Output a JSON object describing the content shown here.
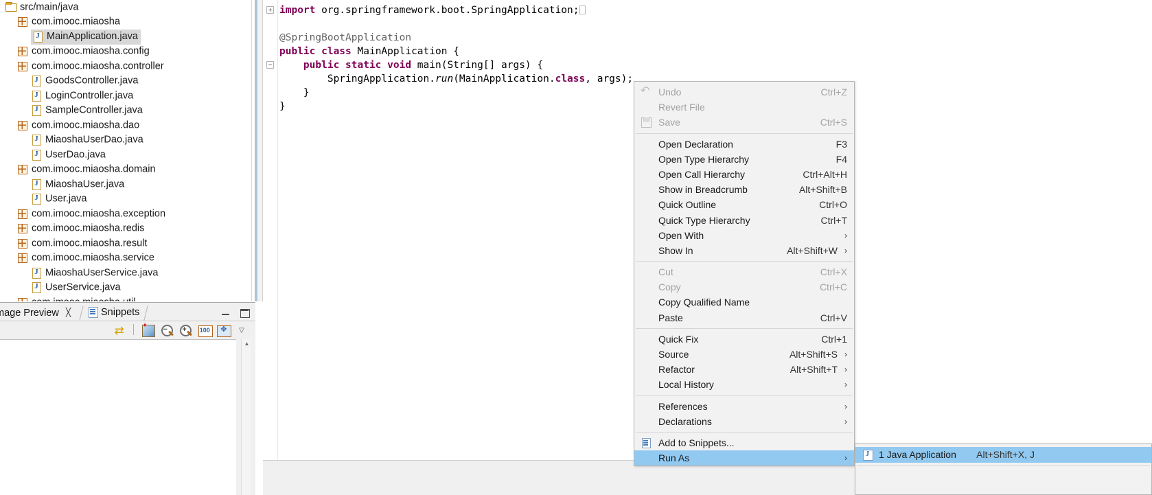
{
  "explorer": {
    "name": "package-explorer",
    "tree": [
      {
        "indent": 0,
        "icon": "folder-icon",
        "label": "src/main/java",
        "selected": false
      },
      {
        "indent": 1,
        "icon": "package-icon",
        "label": "com.imooc.miaosha",
        "selected": false
      },
      {
        "indent": 2,
        "icon": "java-file-icon",
        "label": "MainApplication.java",
        "selected": true
      },
      {
        "indent": 1,
        "icon": "package-icon",
        "label": "com.imooc.miaosha.config",
        "selected": false
      },
      {
        "indent": 1,
        "icon": "package-icon",
        "label": "com.imooc.miaosha.controller",
        "selected": false
      },
      {
        "indent": 2,
        "icon": "java-file-icon",
        "label": "GoodsController.java",
        "selected": false
      },
      {
        "indent": 2,
        "icon": "java-file-icon",
        "label": "LoginController.java",
        "selected": false
      },
      {
        "indent": 2,
        "icon": "java-file-icon",
        "label": "SampleController.java",
        "selected": false
      },
      {
        "indent": 1,
        "icon": "package-icon",
        "label": "com.imooc.miaosha.dao",
        "selected": false
      },
      {
        "indent": 2,
        "icon": "java-file-icon",
        "label": "MiaoshaUserDao.java",
        "selected": false
      },
      {
        "indent": 2,
        "icon": "java-file-icon",
        "label": "UserDao.java",
        "selected": false
      },
      {
        "indent": 1,
        "icon": "package-icon",
        "label": "com.imooc.miaosha.domain",
        "selected": false
      },
      {
        "indent": 2,
        "icon": "java-file-icon",
        "label": "MiaoshaUser.java",
        "selected": false
      },
      {
        "indent": 2,
        "icon": "java-file-icon",
        "label": "User.java",
        "selected": false
      },
      {
        "indent": 1,
        "icon": "package-icon",
        "label": "com.imooc.miaosha.exception",
        "selected": false
      },
      {
        "indent": 1,
        "icon": "package-icon",
        "label": "com.imooc.miaosha.redis",
        "selected": false
      },
      {
        "indent": 1,
        "icon": "package-icon",
        "label": "com.imooc.miaosha.result",
        "selected": false
      },
      {
        "indent": 1,
        "icon": "package-icon",
        "label": "com.imooc.miaosha.service",
        "selected": false
      },
      {
        "indent": 2,
        "icon": "java-file-icon",
        "label": "MiaoshaUserService.java",
        "selected": false
      },
      {
        "indent": 2,
        "icon": "java-file-icon",
        "label": "UserService.java",
        "selected": false
      },
      {
        "indent": 1,
        "icon": "package-icon",
        "label": "com.imooc.miaosha.util",
        "selected": false
      }
    ]
  },
  "bottom_view": {
    "tabs": [
      {
        "label": "mage Preview",
        "active": true,
        "closable": true,
        "icon": "none"
      },
      {
        "label": "Snippets",
        "active": false,
        "closable": false,
        "icon": "snippets-icon"
      }
    ],
    "toolbar": [
      {
        "icon": "sync-icon",
        "name": "link-with-editor-button"
      },
      {
        "icon": "paint-icon",
        "name": "edit-image-button"
      },
      {
        "icon": "zoom-out-icon",
        "name": "zoom-out-button"
      },
      {
        "icon": "zoom-in-icon",
        "name": "zoom-in-button"
      },
      {
        "icon": "zoom-100-icon",
        "name": "actual-size-button"
      },
      {
        "icon": "fit-icon",
        "name": "fit-to-window-button"
      },
      {
        "icon": "chevron-down-icon",
        "name": "view-menu-button"
      }
    ],
    "window_buttons": [
      "minimize",
      "maximize"
    ]
  },
  "editor": {
    "name": "java-editor",
    "code_lines": [
      {
        "segs": [
          {
            "t": "import ",
            "c": "kw"
          },
          {
            "t": "org.springframework.boot.SpringApplication;",
            "c": ""
          }
        ],
        "fold": "plus"
      },
      {
        "segs": [
          {
            "t": "",
            "c": ""
          }
        ]
      },
      {
        "segs": [
          {
            "t": "@SpringBootApplication",
            "c": "ann"
          }
        ]
      },
      {
        "segs": [
          {
            "t": "public class ",
            "c": "kw"
          },
          {
            "t": "MainApplication {",
            "c": ""
          }
        ]
      },
      {
        "segs": [
          {
            "t": "    ",
            "c": ""
          },
          {
            "t": "public static void ",
            "c": "kw"
          },
          {
            "t": "main(String[] args) {",
            "c": ""
          }
        ],
        "fold": "minus"
      },
      {
        "segs": [
          {
            "t": "        SpringApplication.",
            "c": ""
          },
          {
            "t": "run",
            "c": "ital"
          },
          {
            "t": "(MainApplication.",
            "c": ""
          },
          {
            "t": "class",
            "c": "kw"
          },
          {
            "t": ", args);",
            "c": ""
          }
        ]
      },
      {
        "segs": [
          {
            "t": "    }",
            "c": ""
          }
        ]
      },
      {
        "segs": [
          {
            "t": "}",
            "c": ""
          }
        ]
      }
    ]
  },
  "context_menu": {
    "name": "editor-context-menu",
    "items": [
      {
        "label": "Undo",
        "accel": "Ctrl+Z",
        "disabled": true,
        "icon": "undo-icon"
      },
      {
        "label": "Revert File",
        "accel": "",
        "disabled": true,
        "icon": ""
      },
      {
        "label": "Save",
        "accel": "Ctrl+S",
        "disabled": true,
        "icon": "save-icon"
      },
      {
        "separator": true
      },
      {
        "label": "Open Declaration",
        "accel": "F3",
        "disabled": false,
        "icon": ""
      },
      {
        "label": "Open Type Hierarchy",
        "accel": "F4",
        "disabled": false,
        "icon": ""
      },
      {
        "label": "Open Call Hierarchy",
        "accel": "Ctrl+Alt+H",
        "disabled": false,
        "icon": ""
      },
      {
        "label": "Show in Breadcrumb",
        "accel": "Alt+Shift+B",
        "disabled": false,
        "icon": ""
      },
      {
        "label": "Quick Outline",
        "accel": "Ctrl+O",
        "disabled": false,
        "icon": ""
      },
      {
        "label": "Quick Type Hierarchy",
        "accel": "Ctrl+T",
        "disabled": false,
        "icon": ""
      },
      {
        "label": "Open With",
        "accel": "",
        "disabled": false,
        "icon": "",
        "submenu": true
      },
      {
        "label": "Show In",
        "accel": "Alt+Shift+W",
        "disabled": false,
        "icon": "",
        "submenu": true
      },
      {
        "separator": true
      },
      {
        "label": "Cut",
        "accel": "Ctrl+X",
        "disabled": true,
        "icon": ""
      },
      {
        "label": "Copy",
        "accel": "Ctrl+C",
        "disabled": true,
        "icon": ""
      },
      {
        "label": "Copy Qualified Name",
        "accel": "",
        "disabled": false,
        "icon": ""
      },
      {
        "label": "Paste",
        "accel": "Ctrl+V",
        "disabled": false,
        "icon": ""
      },
      {
        "separator": true
      },
      {
        "label": "Quick Fix",
        "accel": "Ctrl+1",
        "disabled": false,
        "icon": ""
      },
      {
        "label": "Source",
        "accel": "Alt+Shift+S",
        "disabled": false,
        "icon": "",
        "submenu": true
      },
      {
        "label": "Refactor",
        "accel": "Alt+Shift+T",
        "disabled": false,
        "icon": "",
        "submenu": true
      },
      {
        "label": "Local History",
        "accel": "",
        "disabled": false,
        "icon": "",
        "submenu": true
      },
      {
        "separator": true
      },
      {
        "label": "References",
        "accel": "",
        "disabled": false,
        "icon": "",
        "submenu": true
      },
      {
        "label": "Declarations",
        "accel": "",
        "disabled": false,
        "icon": "",
        "submenu": true
      },
      {
        "separator": true
      },
      {
        "label": "Add to Snippets...",
        "accel": "",
        "disabled": false,
        "icon": "snippets-icon"
      },
      {
        "label": "Run As",
        "accel": "",
        "disabled": false,
        "icon": "",
        "submenu": true,
        "highlighted": true
      }
    ]
  },
  "submenu": {
    "name": "run-as-submenu",
    "items": [
      {
        "label": "1 Java Application",
        "accel": "Alt+Shift+X, J",
        "icon": "java-run-icon",
        "highlighted": true
      }
    ]
  },
  "colors": {
    "menu_bg": "#f2f2f2",
    "menu_highlight": "#91c9f0",
    "tree_selection": "#d8d8d8",
    "keyword": "#7f0055",
    "annotation": "#646464",
    "sash_blue": "#aac6d8"
  }
}
